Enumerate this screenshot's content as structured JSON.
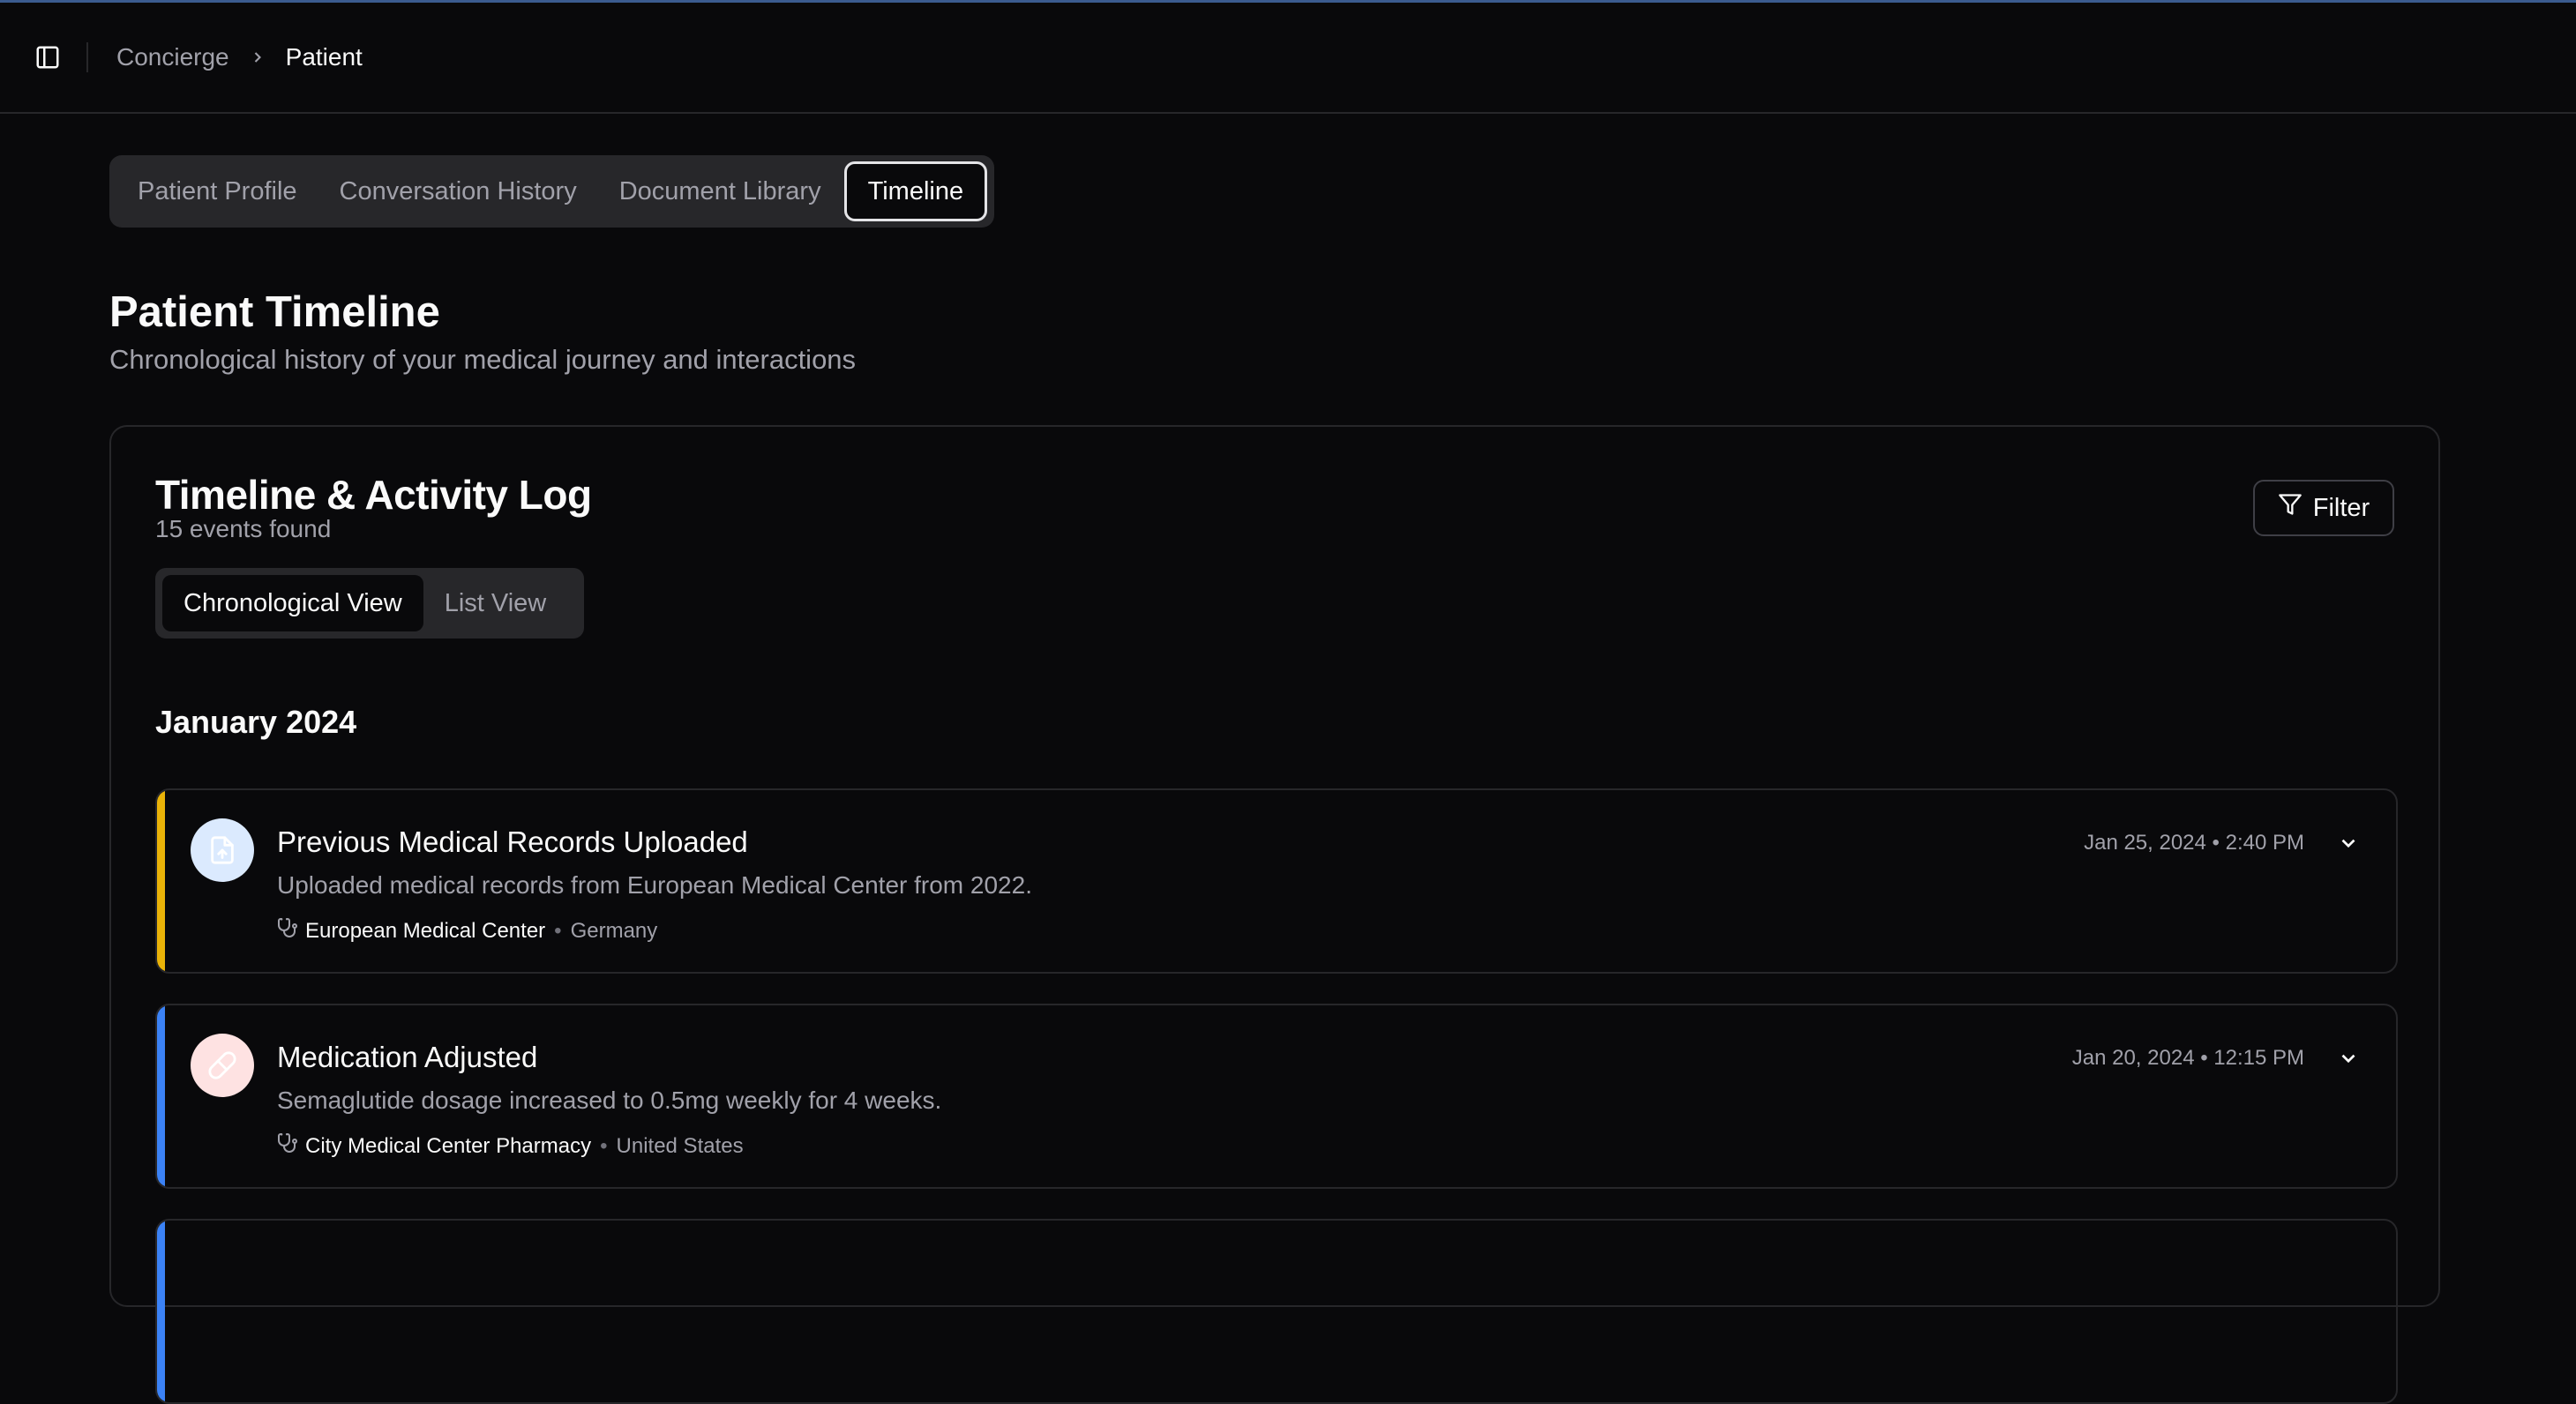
{
  "breadcrumb": {
    "root": "Concierge",
    "current": "Patient"
  },
  "tabs": [
    {
      "label": "Patient Profile"
    },
    {
      "label": "Conversation History"
    },
    {
      "label": "Document Library"
    },
    {
      "label": "Timeline",
      "active": true
    }
  ],
  "page": {
    "title": "Patient Timeline",
    "subtitle": "Chronological history of your medical journey and interactions"
  },
  "card": {
    "title": "Timeline & Activity Log",
    "count": "15 events found",
    "filter_label": "Filter",
    "views": [
      {
        "label": "Chronological View",
        "active": true
      },
      {
        "label": "List View"
      }
    ],
    "month": "January 2024",
    "events": [
      {
        "title": "Previous Medical Records Uploaded",
        "description": "Uploaded medical records from European Medical Center from 2022.",
        "provider": "European Medical Center",
        "location": "Germany",
        "date": "Jan 25, 2024 • 2:40 PM",
        "icon": "file-upload-icon",
        "accent": "#eab308",
        "icon_bg": "#dbeafe"
      },
      {
        "title": "Medication Adjusted",
        "description": "Semaglutide dosage increased to 0.5mg weekly for 4 weeks.",
        "provider": "City Medical Center Pharmacy",
        "location": "United States",
        "date": "Jan 20, 2024 • 12:15 PM",
        "icon": "pill-icon",
        "accent": "#3b82f6",
        "icon_bg": "#fee2e2"
      }
    ]
  },
  "colors": {
    "background": "#09090b",
    "border": "#27272a",
    "muted": "#a1a1aa"
  }
}
